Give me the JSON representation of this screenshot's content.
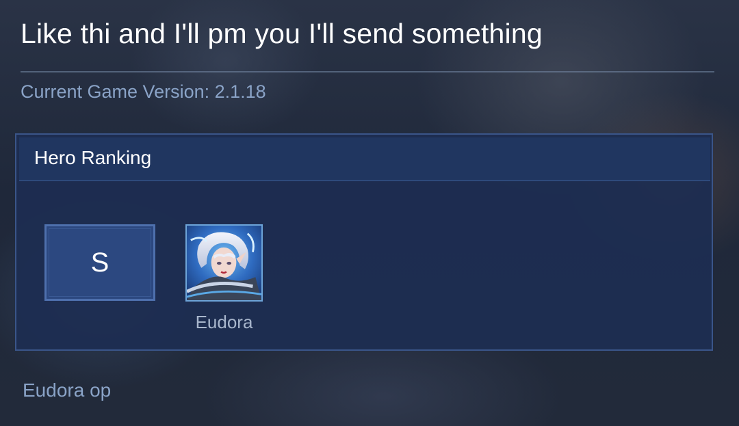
{
  "post": {
    "title": "Like thi and I'll pm you I'll send something",
    "version_text": "Current Game Version: 2.1.18",
    "comment": "Eudora op"
  },
  "ranking": {
    "header": "Hero Ranking",
    "tiers": [
      {
        "tier": "S",
        "heroes": [
          {
            "name": "Eudora",
            "portrait_icon": "hero-portrait-eudora"
          }
        ]
      }
    ]
  },
  "colors": {
    "panel_bg": "#1d2d52",
    "panel_border": "#3a5589",
    "header_bg": "#203660",
    "tier_box": "#2c4880",
    "accent_text": "#8aa3c7",
    "portrait_border": "#6da4d8"
  }
}
